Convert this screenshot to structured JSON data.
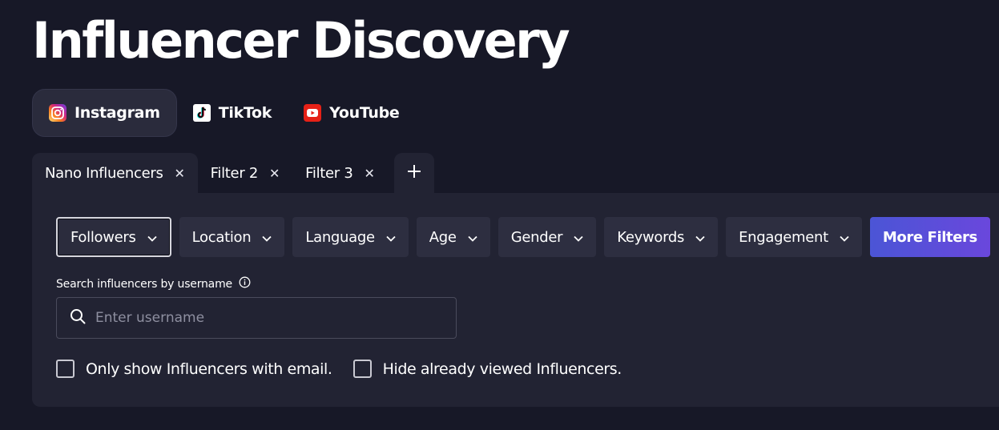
{
  "page": {
    "title": "Influencer Discovery"
  },
  "platforms": [
    {
      "label": "Instagram",
      "icon": "instagram-icon",
      "active": true
    },
    {
      "label": "TikTok",
      "icon": "tiktok-icon",
      "active": false
    },
    {
      "label": "YouTube",
      "icon": "youtube-icon",
      "active": false
    }
  ],
  "tabs": [
    {
      "label": "Nano Influencers",
      "active": true
    },
    {
      "label": "Filter 2",
      "active": false
    },
    {
      "label": "Filter 3",
      "active": false
    }
  ],
  "filters": [
    {
      "label": "Followers"
    },
    {
      "label": "Location"
    },
    {
      "label": "Language"
    },
    {
      "label": "Age"
    },
    {
      "label": "Gender"
    },
    {
      "label": "Keywords"
    },
    {
      "label": "Engagement"
    }
  ],
  "more_filters_label": "More Filters",
  "search": {
    "label": "Search influencers by username",
    "placeholder": "Enter username"
  },
  "checkboxes": [
    {
      "label": "Only show Influencers with email.",
      "checked": false
    },
    {
      "label": "Hide already viewed Influencers.",
      "checked": false
    }
  ],
  "colors": {
    "background": "#171827",
    "panel": "#222333",
    "accent_gradient_start": "#4b55d6",
    "accent_gradient_end": "#6a47dc",
    "youtube_red": "#e62117"
  }
}
